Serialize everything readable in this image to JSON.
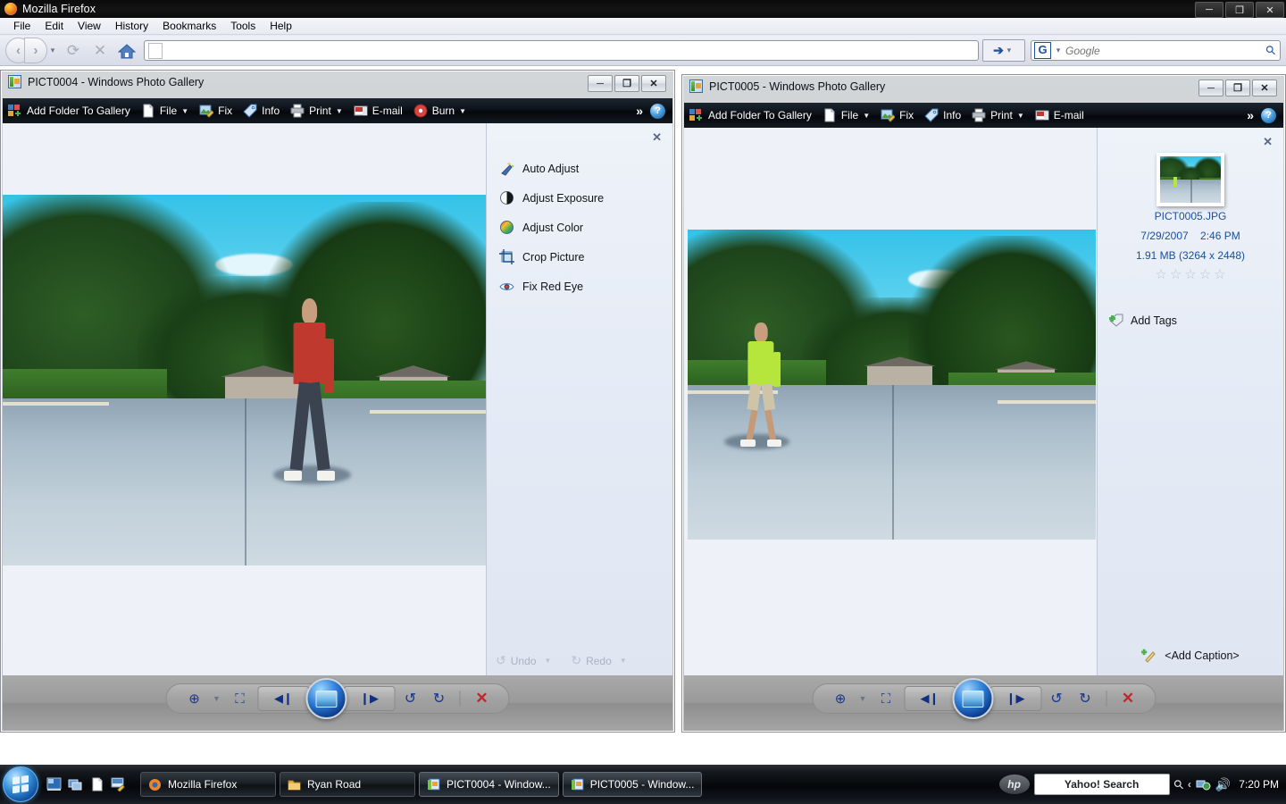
{
  "browser": {
    "title": "Mozilla Firefox",
    "icon": "firefox-icon",
    "menu": [
      "File",
      "Edit",
      "View",
      "History",
      "Bookmarks",
      "Tools",
      "Help"
    ],
    "window_controls": {
      "minimize": "─",
      "maximize": "❐",
      "close": "✕"
    },
    "nav": {
      "back": "‹",
      "forward": "›",
      "reload": "⟳",
      "stop": "✕",
      "home": "⌂",
      "go": "➔"
    },
    "url": {
      "value": "",
      "placeholder": ""
    },
    "search": {
      "engine": "G",
      "placeholder": "Google",
      "value": ""
    }
  },
  "gallery1": {
    "title": "PICT0004 - Windows Photo Gallery",
    "window_controls": {
      "minimize": "─",
      "maximize": "❐",
      "close": "✕"
    },
    "toolbar": [
      {
        "label": "Add Folder To Gallery",
        "icon": "add-folder-icon",
        "caret": false
      },
      {
        "label": "File",
        "icon": "file-icon",
        "caret": true
      },
      {
        "label": "Fix",
        "icon": "fix-icon",
        "caret": false
      },
      {
        "label": "Info",
        "icon": "info-tag-icon",
        "caret": false
      },
      {
        "label": "Print",
        "icon": "printer-icon",
        "caret": true
      },
      {
        "label": "E-mail",
        "icon": "email-icon",
        "caret": false
      },
      {
        "label": "Burn",
        "icon": "burn-icon",
        "caret": true
      }
    ],
    "toolbar_overflow": "»",
    "help": "?",
    "fix_panel": {
      "close": "✕",
      "items": [
        {
          "label": "Auto Adjust",
          "icon": "magic-wand-icon"
        },
        {
          "label": "Adjust Exposure",
          "icon": "exposure-icon"
        },
        {
          "label": "Adjust Color",
          "icon": "color-wheel-icon"
        },
        {
          "label": "Crop Picture",
          "icon": "crop-icon"
        },
        {
          "label": "Fix Red Eye",
          "icon": "red-eye-icon"
        }
      ],
      "undo": {
        "label": "Undo",
        "icon": "undo-icon",
        "caret": "▼",
        "enabled": false
      },
      "redo": {
        "label": "Redo",
        "icon": "redo-icon",
        "caret": "▼",
        "enabled": false
      }
    },
    "navbar": {
      "zoom": "zoom-icon",
      "zoom_caret": "▼",
      "fit": "fit-to-window-icon",
      "previous": "previous-icon",
      "play": "play-slideshow-icon",
      "next": "next-icon",
      "rotate_ccw": "rotate-left-icon",
      "rotate_cw": "rotate-right-icon",
      "delete": "delete-icon"
    },
    "photo": {
      "shirt_color": "#c0392f",
      "pants_color": "#3b4250",
      "alt": "person in red shirt walking across a residential street"
    }
  },
  "gallery2": {
    "title": "PICT0005 - Windows Photo Gallery",
    "window_controls": {
      "minimize": "─",
      "maximize": "❐",
      "close": "✕"
    },
    "toolbar": [
      {
        "label": "Add Folder To Gallery",
        "icon": "add-folder-icon",
        "caret": false
      },
      {
        "label": "File",
        "icon": "file-icon",
        "caret": true
      },
      {
        "label": "Fix",
        "icon": "fix-icon",
        "caret": false
      },
      {
        "label": "Info",
        "icon": "info-tag-icon",
        "caret": false
      },
      {
        "label": "Print",
        "icon": "printer-icon",
        "caret": true
      },
      {
        "label": "E-mail",
        "icon": "email-icon",
        "caret": false
      }
    ],
    "toolbar_overflow": "»",
    "help": "?",
    "info_panel": {
      "close": "✕",
      "filename": "PICT0005.JPG",
      "date": "7/29/2007",
      "time": "2:46 PM",
      "size_and_dimensions": "1.91 MB (3264 x 2448)",
      "rating": 0,
      "stars_total": 5,
      "add_tags": "Add Tags",
      "add_caption": "<Add Caption>"
    },
    "navbar": {
      "zoom": "zoom-icon",
      "zoom_caret": "▼",
      "fit": "fit-to-window-icon",
      "previous": "previous-icon",
      "play": "play-slideshow-icon",
      "next": "next-icon",
      "rotate_ccw": "rotate-left-icon",
      "rotate_cw": "rotate-right-icon",
      "delete": "delete-icon"
    },
    "photo": {
      "shirt_color": "#b6e53b",
      "pants_color": "#cfc4a8",
      "alt": "person in neon green shirt and khaki shorts walking on a street"
    }
  },
  "taskbar": {
    "start": "start-orb",
    "quick_launch": [
      {
        "icon": "show-desktop-icon"
      },
      {
        "icon": "switch-windows-icon"
      },
      {
        "icon": "document-icon"
      },
      {
        "icon": "paint-icon"
      }
    ],
    "tasks": [
      {
        "label": "Mozilla Firefox",
        "icon": "firefox-icon",
        "active": false
      },
      {
        "label": "Ryan Road",
        "icon": "folder-icon",
        "active": false
      },
      {
        "label": "PICT0004 - Window...",
        "icon": "photo-gallery-icon",
        "active": true
      },
      {
        "label": "PICT0005 - Window...",
        "icon": "photo-gallery-icon",
        "active": true
      }
    ],
    "tray": {
      "hp": "hp",
      "search_box": "Yahoo! Search",
      "search_icon": "magnifier-icon",
      "chevron": "‹",
      "network_icon": "network-icon",
      "volume_icon": "volume-icon",
      "clock": "7:20 PM"
    }
  }
}
